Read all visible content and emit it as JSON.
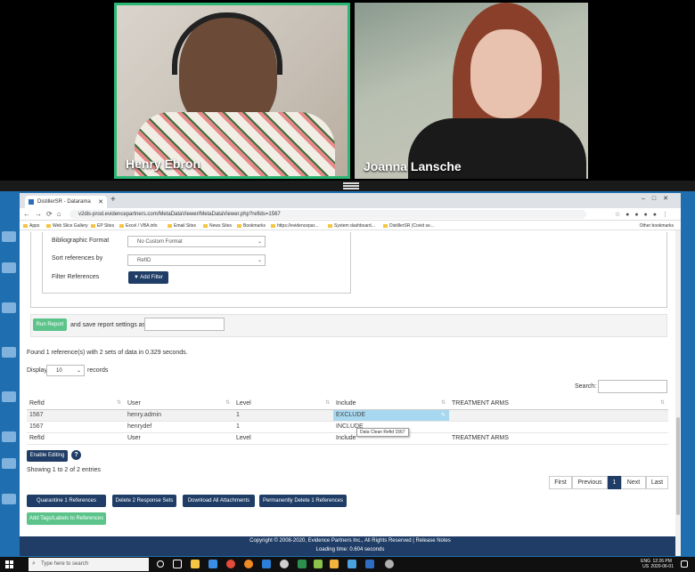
{
  "video": {
    "participants": [
      {
        "name": "Henry Ebron",
        "active": true
      },
      {
        "name": "Joanna Lansche",
        "active": false
      }
    ],
    "active_border_color": "#2bb673"
  },
  "browser": {
    "tab_title": "DistillerSR - Datarama",
    "url": "v2dis-prod.evidencepartners.com/MetaDataViewer/MetaDataViewer.php?refids=1567",
    "bookmarks": [
      "Apps",
      "Web Slice Gallery",
      "EP Sites",
      "Excel / VBA info",
      "Email Sites",
      "News Sites",
      "Bookmarks",
      "https://evidencepar...",
      "System dashboard...",
      "DistillerSR (Covid se..."
    ],
    "other_bookmarks": "Other bookmarks"
  },
  "form": {
    "bibliographic_label": "Bibliographic Format",
    "bibliographic_value": "No Custom Format",
    "sort_label": "Sort references by",
    "sort_value": "RefID",
    "filter_label": "Filter References",
    "add_filter_label": "Add Filter",
    "run_report_label": "Run Report",
    "save_settings_text": "and save report settings as",
    "save_settings_value": ""
  },
  "results": {
    "summary": "Found 1 reference(s) with 2 sets of data in 0.329 seconds.",
    "display_label": "Display",
    "display_value": "10",
    "records_label": "records",
    "search_label": "Search:",
    "search_value": "",
    "columns": [
      "RefId",
      "User",
      "Level",
      "Include",
      "TREATMENT ARMS"
    ],
    "rows": [
      {
        "refid": "1567",
        "user": "henry.admin",
        "level": "1",
        "include": "EXCLUDE",
        "arms": ""
      },
      {
        "refid": "1567",
        "user": "henrydef",
        "level": "1",
        "include": "INCLUDE",
        "arms": ""
      }
    ],
    "tooltip": "Data Clean Refid 1567",
    "enable_editing_label": "Enable Editing",
    "help_label": "?",
    "entries_text": "Showing 1 to 2 of 2 entries",
    "pagination": [
      "First",
      "Previous",
      "1",
      "Next",
      "Last"
    ]
  },
  "actions": {
    "quarantine": "Quarantine 1 References",
    "delete_sets": "Delete 2 Response Sets",
    "download": "Download All Attachments",
    "permanent_delete": "Permanently Delete 1 References",
    "add_tags": "Add Tags/Labels to References"
  },
  "footer": {
    "copyright": "Copyright © 2008-2020, Evidence Partners Inc., All Rights Reserved",
    "release_notes": "Release Notes",
    "loading_time": "Loading time: 0.604 seconds"
  },
  "taskbar": {
    "search_placeholder": "Type here to search",
    "lang_top": "ENG",
    "lang_bottom": "US",
    "time": "12:26 PM",
    "date": "2020-06-01"
  },
  "colors": {
    "navy": "#1f3d66",
    "green": "#5cc48b",
    "exclude_highlight": "#a8d8f0"
  }
}
